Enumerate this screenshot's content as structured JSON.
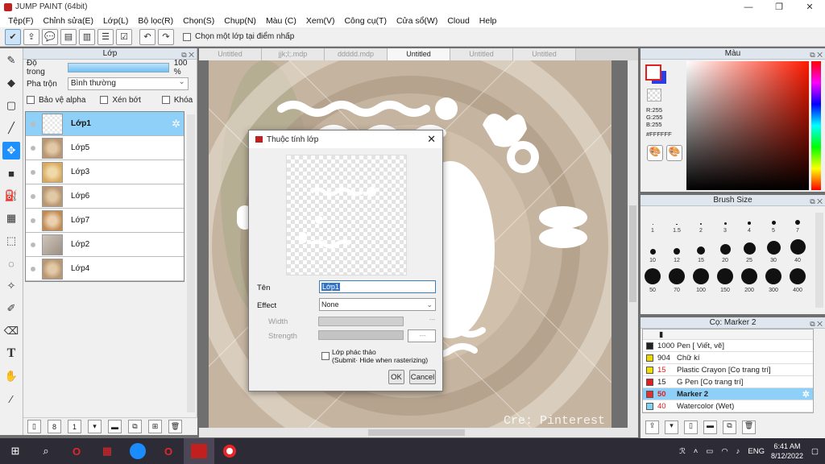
{
  "window": {
    "title": "JUMP PAINT (64bit)"
  },
  "menu": [
    "Tệp(F)",
    "Chỉnh sửa(E)",
    "Lớp(L)",
    "Bộ lọc(R)",
    "Chọn(S)",
    "Chụp(N)",
    "Màu (C)",
    "Xem(V)",
    "Công cụ(T)",
    "Cửa sổ(W)",
    "Cloud",
    "Help"
  ],
  "toolbar": {
    "checkbox_label": "Chọn một lớp tại điểm nhấp"
  },
  "layer_panel": {
    "title": "Lớp",
    "opacity_label": "Độ trong",
    "opacity_value": "100 %",
    "opacity": 1.0,
    "blend_label": "Pha trộn",
    "blend_value": "Bình thường",
    "protect_alpha": "Bảo vệ alpha",
    "clip": "Xén bớt",
    "lock": "Khóa",
    "layers": [
      {
        "name": "Lớp1",
        "selected": true
      },
      {
        "name": "Lớp5"
      },
      {
        "name": "Lớp3"
      },
      {
        "name": "Lớp6"
      },
      {
        "name": "Lớp7"
      },
      {
        "name": "Lớp2"
      },
      {
        "name": "Lớp4"
      }
    ]
  },
  "tabs": [
    {
      "label": "Untitled"
    },
    {
      "label": "jjk;l;.mdp"
    },
    {
      "label": "ddddd.mdp"
    },
    {
      "label": "Untitled",
      "active": true
    },
    {
      "label": "Untitled"
    },
    {
      "label": "Untitled"
    }
  ],
  "canvas": {
    "credit": "Cre: Pinterest"
  },
  "color_panel": {
    "title": "Màu",
    "r": "R:255",
    "g": "G:255",
    "b": "B:255",
    "hex": "#FFFFFF"
  },
  "brush_panel": {
    "title": "Brush Size",
    "sizes": [
      "1",
      "1.5",
      "2",
      "3",
      "4",
      "5",
      "7",
      "10",
      "12",
      "15",
      "20",
      "25",
      "30",
      "40",
      "50",
      "70",
      "100",
      "150",
      "200",
      "300",
      "400"
    ]
  },
  "marker_panel": {
    "title": "Cọ: Marker 2",
    "items": [
      {
        "size": "1000",
        "name": "Pen [ Viết, vẽ]",
        "color": "#222222"
      },
      {
        "size": "904",
        "name": "Chữ kí",
        "color": "#e8d800"
      },
      {
        "size": "15",
        "name": "Plastic Crayon [Cọ trang trí]",
        "color": "#f0e000",
        "sizecolor": "#e02020"
      },
      {
        "size": "15",
        "name": "G Pen [Cọ trang trí]",
        "color": "#e02020"
      },
      {
        "size": "50",
        "name": "Marker 2",
        "color": "#e03030",
        "sizecolor": "#e02020",
        "selected": true
      },
      {
        "size": "40",
        "name": "Watercolor (Wet)",
        "color": "#7fd3f0",
        "sizecolor": "#e02020"
      }
    ]
  },
  "dialog": {
    "title": "Thuộc tính lớp",
    "name_label": "Tên",
    "name_value": "Lớp1",
    "effect_label": "Effect",
    "effect_value": "None",
    "width_label": "Width",
    "strength_label": "Strength",
    "draft_label": "Lớp phác thảo",
    "draft_note": "(Submit· Hide when rasterizing)",
    "ok": "OK",
    "cancel": "Cancel",
    "width_value": "---",
    "strength_value": "---"
  },
  "taskbar": {
    "lang": "ENG",
    "time": "6:41 AM",
    "date": "8/12/2022"
  }
}
